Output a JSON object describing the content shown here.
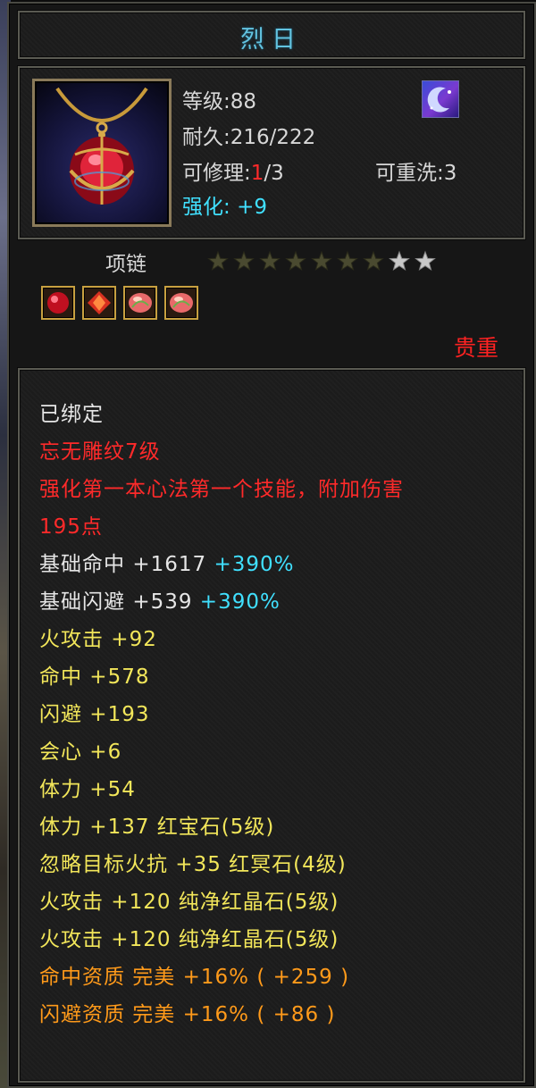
{
  "item": {
    "name": "烈日",
    "level_label": "等级:88",
    "durability_label": "耐久:216/222",
    "repair_prefix": "可修理:",
    "repair_current": "1",
    "repair_total": "/3",
    "rewash_label": "可重洗:3",
    "enhance_label": "强化:",
    "enhance_value": "+9",
    "type": "项链",
    "stars_filled": 7,
    "stars_total": 9,
    "rarity": "贵重"
  },
  "gems": [
    {
      "icon": "red-gem-icon"
    },
    {
      "icon": "red-crystal-icon"
    },
    {
      "icon": "pink-gem-icon"
    },
    {
      "icon": "pink-gem-icon"
    }
  ],
  "bound": "已绑定",
  "engraving": "忘无雕纹7级",
  "engraving_effect_line1": "强化第一本心法第一个技能，附加伤害",
  "engraving_effect_line2": "195点",
  "base_stats": [
    {
      "name": "基础命中",
      "value": "+1617",
      "bonus": "+390%"
    },
    {
      "name": "基础闪避",
      "value": "+539",
      "bonus": "+390%"
    }
  ],
  "attributes": [
    "火攻击 +92",
    "命中 +578",
    "闪避 +193",
    "会心 +6",
    "体力 +54",
    "体力 +137 红宝石(5级)",
    "忽略目标火抗 +35 红冥石(4级)",
    "火攻击 +120 纯净红晶石(5级)",
    "火攻击 +120 纯净红晶石(5级)"
  ],
  "qualities": [
    "命中资质   完美 +16% ( +259 )",
    "闪避资质   完美 +16% ( +86 )"
  ],
  "colors": {
    "title": "#62c3e0",
    "enhance": "#40e0ff",
    "engraving": "#ff2a2a",
    "attribute": "#f2e65a",
    "quality": "#ff9a1a",
    "star_filled": "#4a4a30",
    "star_empty": "#c8c8c8"
  }
}
